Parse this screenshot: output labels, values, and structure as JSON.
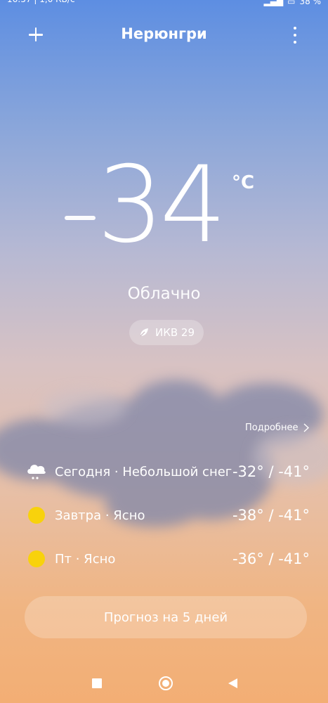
{
  "status_bar": {
    "time_speed": "16:57 | 1,0 КБ/с",
    "battery": "38 %"
  },
  "header": {
    "city": "Нерюнгри",
    "add_icon": "plus-icon",
    "menu_icon": "more-vertical-icon"
  },
  "current": {
    "temperature": "34",
    "unit": "°C",
    "condition": "Облачно",
    "aqi_label": "ИКВ 29",
    "aqi_icon": "leaf-icon"
  },
  "details_link": "Подробнее",
  "forecast": [
    {
      "label": "Сегодня · Небольшой снег",
      "temps": "-32° / -41°",
      "icon": "cloud-snow-icon"
    },
    {
      "label": "Завтра · Ясно",
      "temps": "-38° / -41°",
      "icon": "sun-icon"
    },
    {
      "label": "Пт · Ясно",
      "temps": "-36° / -41°",
      "icon": "sun-icon"
    }
  ],
  "forecast_button": "Прогноз на 5 дней",
  "colors": {
    "sun": "#f8d20c",
    "sky_top": "#5d8ee2",
    "sky_bottom": "#f3ae74"
  }
}
